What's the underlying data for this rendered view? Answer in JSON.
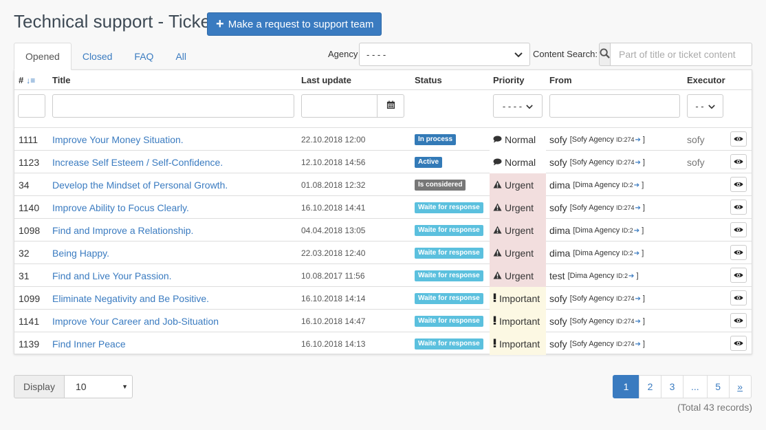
{
  "header": {
    "title": "Technical support - Tickets",
    "request_button": "Make a request to support team"
  },
  "tabs": [
    {
      "label": "Opened",
      "active": true
    },
    {
      "label": "Closed",
      "active": false
    },
    {
      "label": "FAQ",
      "active": false
    },
    {
      "label": "All",
      "active": false
    }
  ],
  "filters": {
    "agency_label": "Agency",
    "agency_value": "- - - -",
    "content_search_label": "Content Search:",
    "content_search_placeholder": "Part of title or ticket content",
    "priority_value": "- - - -",
    "executor_value": "- -"
  },
  "columns": {
    "id": "#",
    "title": "Title",
    "last_update": "Last update",
    "status": "Status",
    "priority": "Priority",
    "from": "From",
    "executor": "Executor"
  },
  "colors": {
    "accent": "#3a7bc0",
    "status_in_process": "#337ab7",
    "status_active": "#337ab7",
    "status_considered": "#777777",
    "status_waite": "#5bc0de",
    "priority_urgent_bg": "#f2dede",
    "priority_important_bg": "#fcf8e3"
  },
  "rows": [
    {
      "id": "1111",
      "title": "Improve Your Money Situation.",
      "date": "22.10.2018 12:00",
      "status": "In process",
      "status_color": "#337ab7",
      "prio_icon": "comment-icon",
      "priority": "Normal",
      "prio_bg": "#ffffff",
      "from_name": "sofy",
      "from_agency": "[Sofy Agency ",
      "from_id": "ID:274",
      "from_end": " ]",
      "executor": "sofy"
    },
    {
      "id": "1123",
      "title": "Increase Self Esteem / Self-Confidence.",
      "date": "12.10.2018 14:56",
      "status": "Active",
      "status_color": "#337ab7",
      "prio_icon": "comment-icon",
      "priority": "Normal",
      "prio_bg": "#ffffff",
      "from_name": "sofy",
      "from_agency": "[Sofy Agency ",
      "from_id": "ID:274",
      "from_end": " ]",
      "executor": "sofy"
    },
    {
      "id": "34",
      "title": "Develop the Mindset of Personal Growth.",
      "date": "01.08.2018 12:32",
      "status": "Is considered",
      "status_color": "#777777",
      "prio_icon": "warning-icon",
      "priority": "Urgent",
      "prio_bg": "#f2dede",
      "from_name": "dima",
      "from_agency": "[Dima Agency ",
      "from_id": "ID:2",
      "from_end": " ]",
      "executor": ""
    },
    {
      "id": "1140",
      "title": "Improve Ability to Focus Clearly.",
      "date": "16.10.2018 14:41",
      "status": "Waite for response",
      "status_color": "#5bc0de",
      "prio_icon": "warning-icon",
      "priority": "Urgent",
      "prio_bg": "#f2dede",
      "from_name": "sofy",
      "from_agency": "[Sofy Agency ",
      "from_id": "ID:274",
      "from_end": " ]",
      "executor": ""
    },
    {
      "id": "1098",
      "title": "Find and Improve a Relationship.",
      "date": "04.04.2018 13:05",
      "status": "Waite for response",
      "status_color": "#5bc0de",
      "prio_icon": "warning-icon",
      "priority": "Urgent",
      "prio_bg": "#f2dede",
      "from_name": "dima",
      "from_agency": "[Dima Agency ",
      "from_id": "ID:2",
      "from_end": " ]",
      "executor": ""
    },
    {
      "id": "32",
      "title": "Being Happy.",
      "date": "22.03.2018 12:40",
      "status": "Waite for response",
      "status_color": "#5bc0de",
      "prio_icon": "warning-icon",
      "priority": "Urgent",
      "prio_bg": "#f2dede",
      "from_name": "dima",
      "from_agency": "[Dima Agency ",
      "from_id": "ID:2",
      "from_end": " ]",
      "executor": ""
    },
    {
      "id": "31",
      "title": "Find and Live Your Passion.",
      "date": "10.08.2017 11:56",
      "status": "Waite for response",
      "status_color": "#5bc0de",
      "prio_icon": "warning-icon",
      "priority": "Urgent",
      "prio_bg": "#f2dede",
      "from_name": "test",
      "from_agency": "[Dima Agency ",
      "from_id": "ID:2",
      "from_end": " ]",
      "executor": ""
    },
    {
      "id": "1099",
      "title": "Eliminate Negativity and Be Positive.",
      "date": "16.10.2018 14:14",
      "status": "Waite for response",
      "status_color": "#5bc0de",
      "prio_icon": "exclamation-icon",
      "priority": "Important",
      "prio_bg": "#fcf8e3",
      "from_name": "sofy",
      "from_agency": "[Sofy Agency ",
      "from_id": "ID:274",
      "from_end": " ]",
      "executor": ""
    },
    {
      "id": "1141",
      "title": "Improve Your Career and Job-Situation",
      "date": "16.10.2018 14:47",
      "status": "Waite for response",
      "status_color": "#5bc0de",
      "prio_icon": "exclamation-icon",
      "priority": "Important",
      "prio_bg": "#fcf8e3",
      "from_name": "sofy",
      "from_agency": "[Sofy Agency ",
      "from_id": "ID:274",
      "from_end": " ]",
      "executor": ""
    },
    {
      "id": "1139",
      "title": "Find Inner Peace",
      "date": "16.10.2018 14:13",
      "status": "Waite for response",
      "status_color": "#5bc0de",
      "prio_icon": "exclamation-icon",
      "priority": "Important",
      "prio_bg": "#fcf8e3",
      "from_name": "sofy",
      "from_agency": "[Sofy Agency ",
      "from_id": "ID:274",
      "from_end": " ]",
      "executor": ""
    }
  ],
  "footer": {
    "display_label": "Display",
    "display_value": "10",
    "pages": [
      "1",
      "2",
      "3",
      "...",
      "5",
      "»"
    ],
    "current_page": "1",
    "total": "(Total 43 records)"
  }
}
